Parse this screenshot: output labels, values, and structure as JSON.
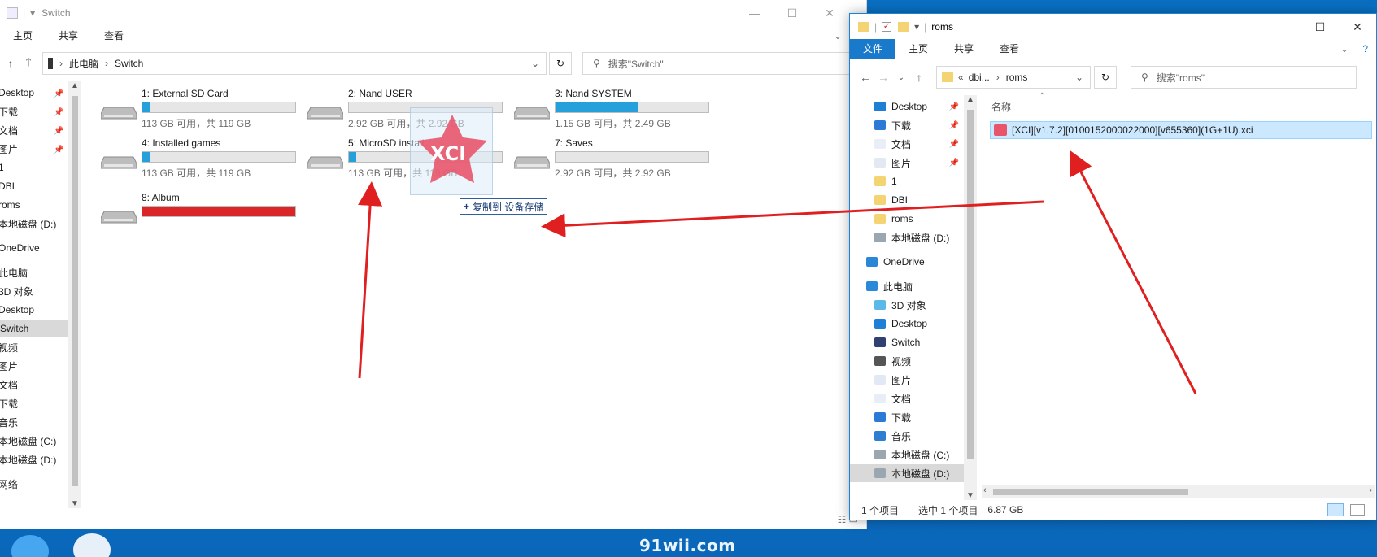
{
  "left_window": {
    "title": "Switch",
    "tabs": [
      "主页",
      "共享",
      "查看"
    ],
    "address": {
      "root": "此电脑",
      "current": "Switch"
    },
    "search_placeholder": "搜索\"Switch\"",
    "nav_items": [
      "Desktop",
      "下载",
      "文档",
      "图片",
      "1",
      "DBI",
      "roms",
      "本地磁盘 (D:)",
      "OneDrive",
      "此电脑",
      "3D 对象",
      "Desktop",
      "Switch",
      "视频",
      "图片",
      "文档",
      "下载",
      "音乐",
      "本地磁盘 (C:)",
      "本地磁盘 (D:)",
      "网络"
    ],
    "selected_nav": "Switch",
    "drives": [
      {
        "name": "1: External SD Card",
        "info": "113 GB 可用，共 119 GB",
        "used_fraction": 0.05
      },
      {
        "name": "2: Nand USER",
        "info": "2.92 GB 可用，共 2.92 GB",
        "used_fraction": 0.0
      },
      {
        "name": "3: Nand SYSTEM",
        "info": "1.15 GB 可用，共 2.49 GB",
        "used_fraction": 0.54
      },
      {
        "name": "4: Installed games",
        "info": "113 GB 可用，共 119 GB",
        "used_fraction": 0.05
      },
      {
        "name": "5: MicroSD install",
        "info": "113 GB 可用，共 119 GB",
        "used_fraction": 0.05
      },
      {
        "name": "7: Saves",
        "info": "2.92 GB 可用，共 2.92 GB",
        "used_fraction": 0.0
      },
      {
        "name": "8: Album",
        "info": "",
        "used_fraction": 1.0
      }
    ],
    "drag_badge": "XCI",
    "drag_hint": "复制到 设备存储"
  },
  "right_window": {
    "title": "roms",
    "tabs": [
      "文件",
      "主页",
      "共享",
      "查看"
    ],
    "address": {
      "prefix": "«",
      "parent": "dbi...",
      "current": "roms"
    },
    "search_placeholder": "搜索\"roms\"",
    "nav_items": [
      "Desktop",
      "下载",
      "文档",
      "图片",
      "1",
      "DBI",
      "roms",
      "本地磁盘 (D:)",
      "OneDrive",
      "此电脑",
      "3D 对象",
      "Desktop",
      "Switch",
      "视频",
      "图片",
      "文档",
      "下载",
      "音乐",
      "本地磁盘 (C:)",
      "本地磁盘 (D:)"
    ],
    "selected_nav": "本地磁盘 (D:)",
    "column_header": "名称",
    "file": "[XCI][v1.7.2][0100152000022000][v655360](1G+1U).xci",
    "status": {
      "count": "1 个项目",
      "selected": "选中 1 个项目",
      "size": "6.87 GB"
    }
  },
  "watermark": "91wii.com",
  "colors": {
    "accent": "#1979ca",
    "arrow": "#e02020",
    "drive_fill": "#26a0da",
    "drive_full": "#da2626"
  }
}
